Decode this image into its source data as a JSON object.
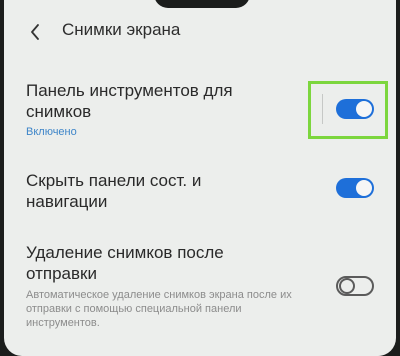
{
  "header": {
    "title": "Снимки экрана"
  },
  "settings": [
    {
      "label": "Панель инструментов для снимков",
      "status": "Включено",
      "enabled": true
    },
    {
      "label": "Скрыть панели сост. и навигации",
      "enabled": true
    },
    {
      "label": "Удаление снимков после отправки",
      "description": "Автоматическое удаление снимков экрана после их отправки с помощью специальной панели инструментов.",
      "enabled": false
    }
  ],
  "colors": {
    "accent": "#1e6fd9",
    "highlight": "#7cd63e",
    "status": "#3f86c9"
  }
}
